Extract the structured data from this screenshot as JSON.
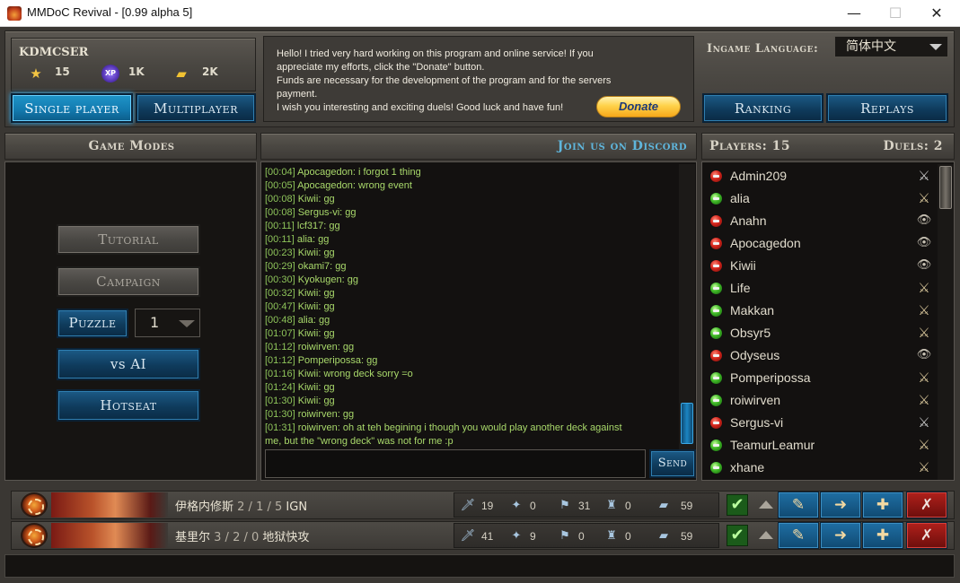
{
  "window": {
    "title": "MMDoC Revival - [0.99 alpha 5]",
    "min": "—",
    "max": "☐",
    "close": "✕"
  },
  "user": {
    "name": "KDMCSER",
    "stars": "15",
    "xp": "1K",
    "gold": "2K"
  },
  "mode_buttons": {
    "single": "Single player",
    "multi": "Multiplayer"
  },
  "message": {
    "line1": "Hello! I tried very hard working on this program and online service! If you",
    "line2": "appreciate my efforts, click the \"Donate\" button.",
    "line3": "Funds are necessary for the development of the program and for the servers",
    "line4": "payment.",
    "line5": "I wish you interesting and exciting duels! Good luck and have fun!",
    "donate": "Donate"
  },
  "language": {
    "label": "Ingame Language:",
    "value": "简体中文"
  },
  "top_right_buttons": {
    "ranking": "Ranking",
    "replays": "Replays"
  },
  "headers": {
    "game_modes": "Game Modes",
    "discord": "Join us on Discord",
    "players": "Players: 15",
    "duels": "Duels: 2"
  },
  "game_modes": {
    "tutorial": "Tutorial",
    "campaign": "Campaign",
    "puzzle": "Puzzle",
    "puzzle_value": "1",
    "vs_ai": "vs AI",
    "hotseat": "Hotseat"
  },
  "chat": {
    "send": "Send",
    "input_value": "",
    "lines": [
      {
        "t": "[00:04]",
        "u": "Apocagedon:",
        "m": "i forgot 1 thing"
      },
      {
        "t": "[00:05]",
        "u": "Apocagedon:",
        "m": "wrong event"
      },
      {
        "t": "[00:08]",
        "u": "Kiwii:",
        "m": "gg"
      },
      {
        "t": "[00:08]",
        "u": "Sergus-vi:",
        "m": "gg"
      },
      {
        "t": "[00:11]",
        "u": "lcf317:",
        "m": "gg"
      },
      {
        "t": "[00:11]",
        "u": "alia:",
        "m": "gg"
      },
      {
        "t": "[00:23]",
        "u": "Kiwii:",
        "m": "gg"
      },
      {
        "t": "[00:29]",
        "u": "okami7:",
        "m": "gg"
      },
      {
        "t": "[00:30]",
        "u": "Kyokugen:",
        "m": "gg"
      },
      {
        "t": "[00:32]",
        "u": "Kiwii:",
        "m": "gg"
      },
      {
        "t": "[00:47]",
        "u": "Kiwii:",
        "m": "gg"
      },
      {
        "t": "[00:48]",
        "u": "alia:",
        "m": "gg"
      },
      {
        "t": "[01:07]",
        "u": "Kiwii:",
        "m": "gg"
      },
      {
        "t": "[01:12]",
        "u": "roiwirven:",
        "m": "gg"
      },
      {
        "t": "[01:12]",
        "u": "Pomperipossa:",
        "m": "gg"
      },
      {
        "t": "[01:16]",
        "u": "Kiwii:",
        "m": "wrong deck sorry =o"
      },
      {
        "t": "[01:24]",
        "u": "Kiwii:",
        "m": "gg"
      },
      {
        "t": "[01:30]",
        "u": "Kiwii:",
        "m": "gg"
      },
      {
        "t": "[01:30]",
        "u": "roiwirven:",
        "m": "gg"
      },
      {
        "t": "[01:31]",
        "u": "roiwirven:",
        "m": "oh at teh begining i though you would play another deck against"
      },
      {
        "t": "",
        "u": "",
        "m": "me, but the \"wrong deck\" was not for me :p"
      }
    ]
  },
  "players": [
    {
      "name": "Admin209",
      "status": "red",
      "action": "swords-grey-icon"
    },
    {
      "name": "alia",
      "status": "green",
      "action": "swords-icon"
    },
    {
      "name": "Anahn",
      "status": "red",
      "action": "eye-icon"
    },
    {
      "name": "Apocagedon",
      "status": "red",
      "action": "eye-icon"
    },
    {
      "name": "Kiwii",
      "status": "red",
      "action": "eye-icon"
    },
    {
      "name": "Life",
      "status": "green",
      "action": "swords-icon"
    },
    {
      "name": "Makkan",
      "status": "green",
      "action": "swords-icon"
    },
    {
      "name": "Obsyr5",
      "status": "green",
      "action": "swords-icon"
    },
    {
      "name": "Odyseus",
      "status": "red",
      "action": "eye-icon"
    },
    {
      "name": "Pomperipossa",
      "status": "green",
      "action": "swords-icon"
    },
    {
      "name": "roiwirven",
      "status": "green",
      "action": "swords-icon"
    },
    {
      "name": "Sergus-vi",
      "status": "red",
      "action": "swords-grey-icon"
    },
    {
      "name": "TeamurLeamur",
      "status": "green",
      "action": "swords-icon"
    },
    {
      "name": "xhane",
      "status": "green",
      "action": "swords-icon"
    }
  ],
  "decks": [
    {
      "hero": "伊格内修斯",
      "record": "2 / 1 / 5",
      "tag": "IGN",
      "attack": "19",
      "magic": "0",
      "flags": "31",
      "towers": "0",
      "cards": "59"
    },
    {
      "hero": "基里尔",
      "record": "3 / 2 / 0",
      "tag": "地狱快攻",
      "attack": "41",
      "magic": "9",
      "flags": "0",
      "towers": "0",
      "cards": "59"
    }
  ]
}
